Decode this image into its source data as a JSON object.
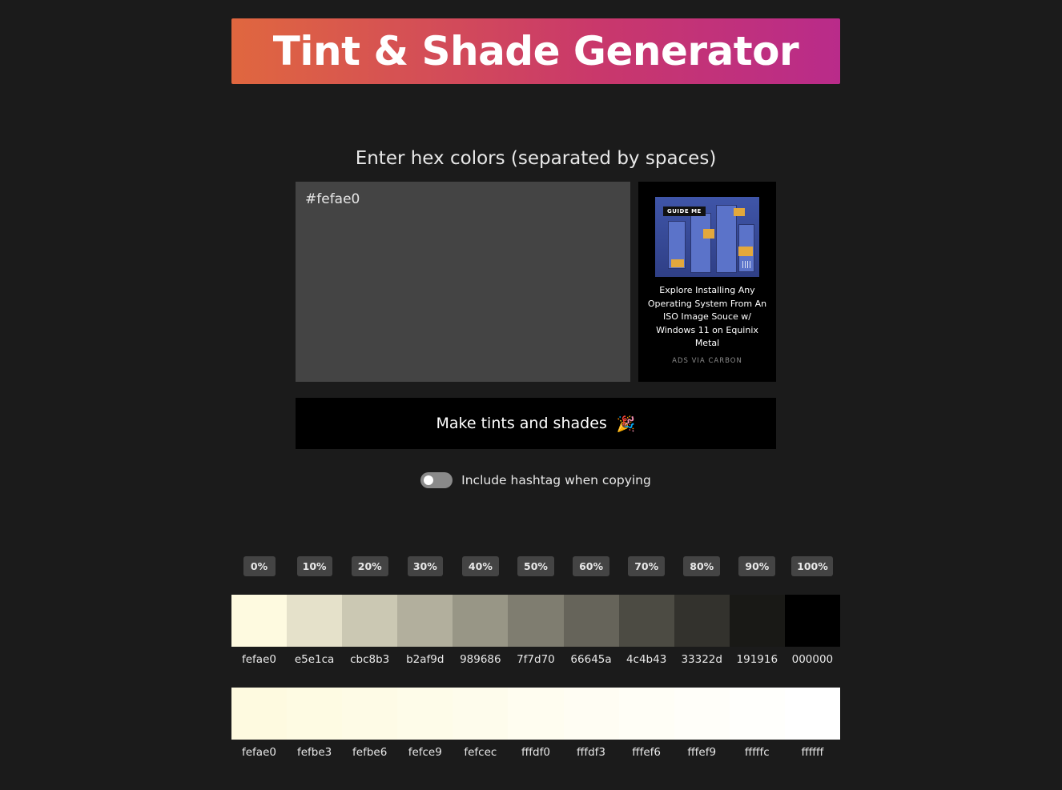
{
  "title": "Tint & Shade Generator",
  "prompt": "Enter hex colors (separated by spaces)",
  "input": {
    "value": "#fefae0",
    "placeholder": ""
  },
  "ad": {
    "badge": "GUIDE ME",
    "text": "Explore Installing Any Operating System From An ISO Image Souce w/ Windows 11 on Equinix Metal",
    "via": "ADS VIA CARBON"
  },
  "make_button": {
    "label": "Make tints and shades",
    "emoji": "🎉"
  },
  "toggle": {
    "label": "Include hashtag when copying",
    "on": false
  },
  "percentages": [
    "0%",
    "10%",
    "20%",
    "30%",
    "40%",
    "50%",
    "60%",
    "70%",
    "80%",
    "90%",
    "100%"
  ],
  "shades": [
    "fefae0",
    "e5e1ca",
    "cbc8b3",
    "b2af9d",
    "989686",
    "7f7d70",
    "66645a",
    "4c4b43",
    "33322d",
    "191916",
    "000000"
  ],
  "tints": [
    "fefae0",
    "fefbe3",
    "fefbe6",
    "fefce9",
    "fefcec",
    "fffdf0",
    "fffdf3",
    "fffef6",
    "fffef9",
    "fffffc",
    "ffffff"
  ]
}
